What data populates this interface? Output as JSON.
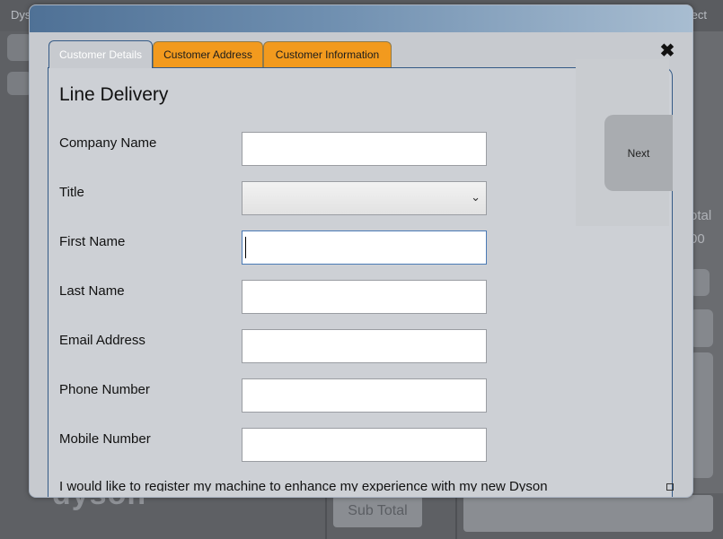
{
  "background": {
    "app_title": "Dys",
    "right_title": "ect",
    "total_label": "otal",
    "total_value": "00",
    "logo_text": "dyson",
    "subtotal_label": "Sub Total"
  },
  "tabs": [
    {
      "label": "Customer Details",
      "active": true
    },
    {
      "label": "Customer Address",
      "active": false
    },
    {
      "label": "Customer Information",
      "active": false
    }
  ],
  "close_glyph": "✖",
  "form": {
    "title": "Line Delivery",
    "fields": [
      {
        "label": "Company Name",
        "value": "",
        "type": "text"
      },
      {
        "label": "Title",
        "value": "",
        "type": "select"
      },
      {
        "label": "First Name",
        "value": "",
        "type": "text",
        "focused": true
      },
      {
        "label": "Last Name",
        "value": "",
        "type": "text"
      },
      {
        "label": "Email Address",
        "value": "",
        "type": "text"
      },
      {
        "label": "Phone Number",
        "value": "",
        "type": "text"
      },
      {
        "label": "Mobile Number",
        "value": "",
        "type": "text"
      }
    ],
    "register_text": "I would like to register my machine to enhance my experience with my new Dyson"
  },
  "next_label": "Next",
  "colors": {
    "tab_orange": "#f29a1e",
    "header_blue": "#4f7196",
    "panel_border": "#345a86"
  }
}
